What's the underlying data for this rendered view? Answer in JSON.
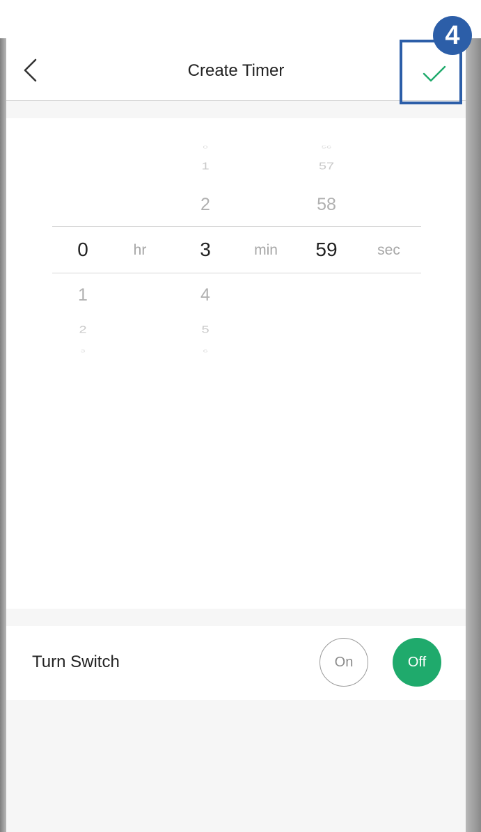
{
  "header": {
    "title": "Create Timer",
    "step_badge": "4"
  },
  "picker": {
    "hours": {
      "above": [],
      "selected": "0",
      "below": [
        "1",
        "2",
        "3"
      ],
      "unit": "hr"
    },
    "minutes": {
      "above": [
        "0",
        "1",
        "2"
      ],
      "selected": "3",
      "below": [
        "4",
        "5",
        "6"
      ],
      "unit": "min"
    },
    "seconds": {
      "above": [
        "56",
        "57",
        "58"
      ],
      "selected": "59",
      "below": [],
      "unit": "sec"
    }
  },
  "switch": {
    "label": "Turn Switch",
    "on_label": "On",
    "off_label": "Off",
    "selected": "Off"
  },
  "colors": {
    "accent_green": "#1faa6c",
    "highlight_blue": "#2c5ea8"
  },
  "icons": {
    "back": "chevron-left-icon",
    "confirm": "checkmark-icon"
  }
}
